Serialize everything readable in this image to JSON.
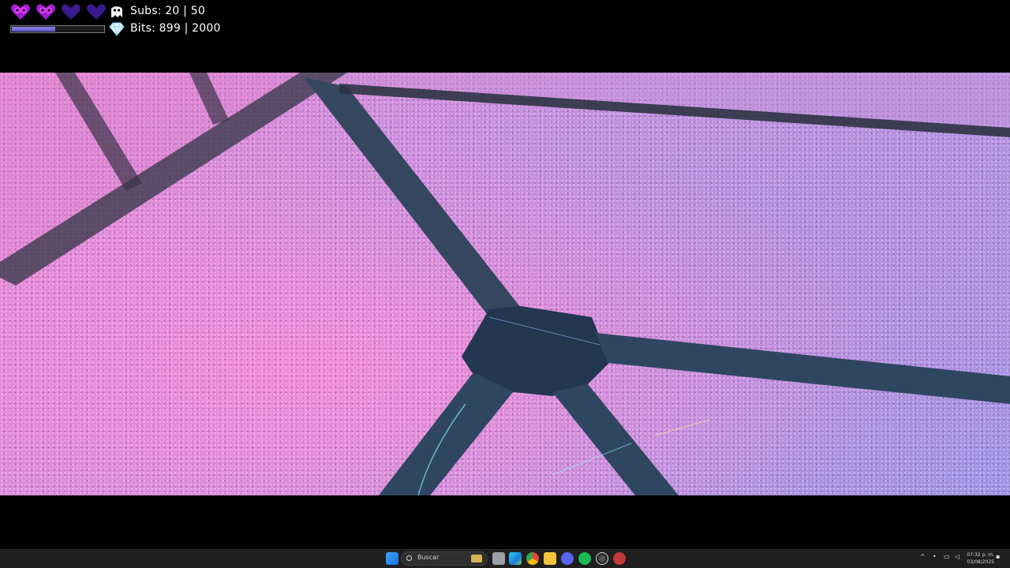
{
  "hud": {
    "hearts": [
      {
        "state": "face"
      },
      {
        "state": "face"
      },
      {
        "state": "empty"
      },
      {
        "state": "empty"
      }
    ],
    "subs_text": "Subs: 20 | 50",
    "bits_text": "Bits: 899 | 2000",
    "progress_fraction": 0.47,
    "colors": {
      "heart_full": "#a21fcf",
      "heart_empty": "#3a1a8e",
      "progress": "#6f69d8"
    },
    "icons": [
      "heart-icon",
      "ghost-icon",
      "diamond-icon"
    ]
  },
  "scene": {
    "subject": "stadium-crowd",
    "colors": {
      "crowd_pink": "#e785d3",
      "crowd_violet": "#9e94e4",
      "walkway": "#2b3c5a"
    }
  },
  "taskbar": {
    "search_label": "Buscar",
    "apps": [
      "windows-start",
      "widgets",
      "file-explorer",
      "edge",
      "chrome",
      "folder",
      "discord",
      "spotify",
      "obs",
      "app"
    ],
    "clock_time": "07:32 p. m.",
    "clock_date": "03/08/2025"
  }
}
